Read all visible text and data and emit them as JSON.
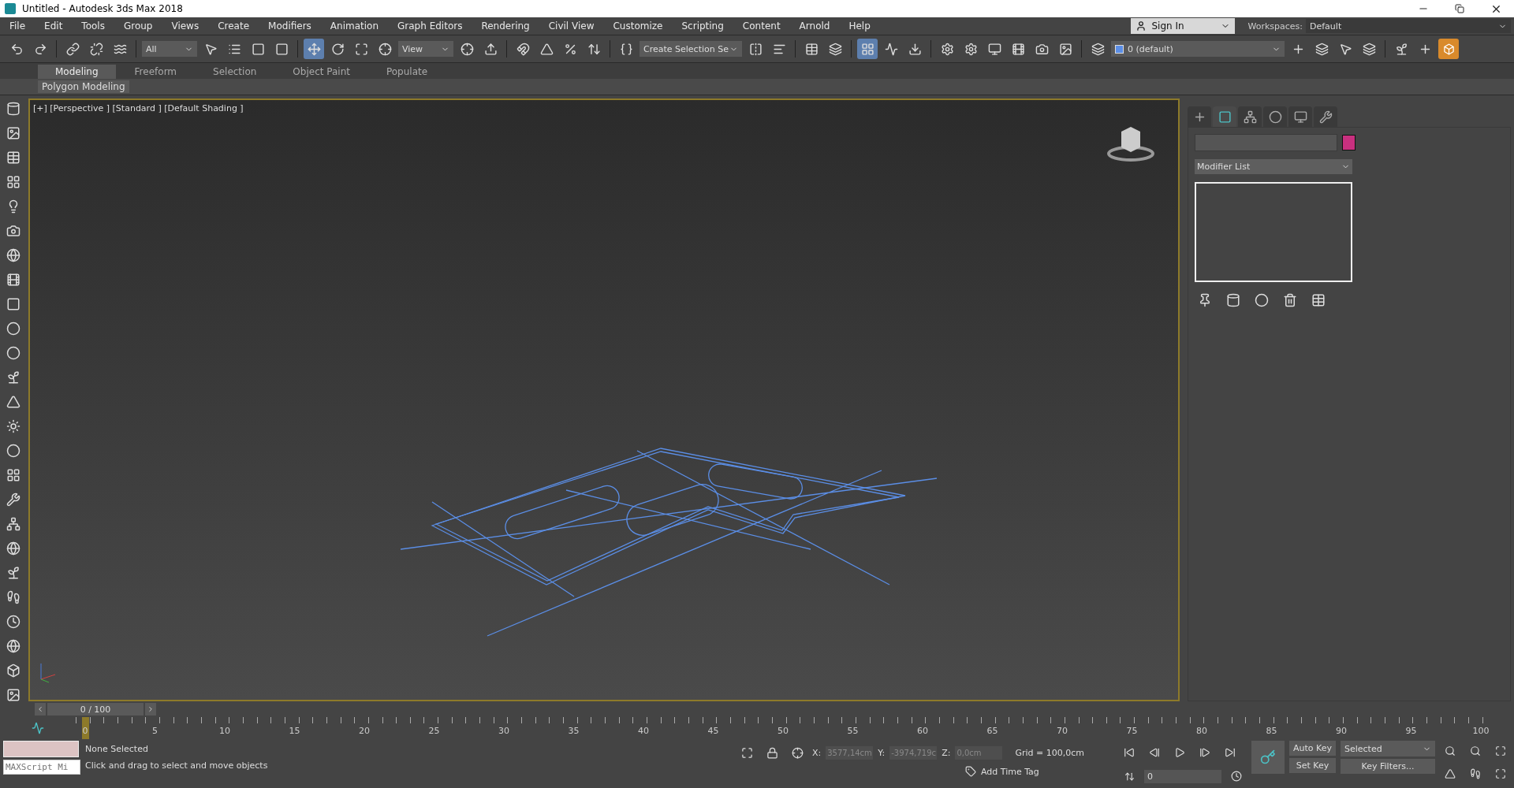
{
  "window": {
    "title": "Untitled - Autodesk 3ds Max 2018"
  },
  "menu": [
    "File",
    "Edit",
    "Tools",
    "Group",
    "Views",
    "Create",
    "Modifiers",
    "Animation",
    "Graph Editors",
    "Rendering",
    "Civil View",
    "Customize",
    "Scripting",
    "Content",
    "Arnold",
    "Help"
  ],
  "account": {
    "sign_in": "Sign In",
    "workspaces_label": "Workspaces:",
    "workspace": "Default"
  },
  "toolbar": {
    "selection_filter": "All",
    "coordinate_system": "View",
    "named_selection": "Create Selection Se",
    "layer": "0 (default)"
  },
  "ribbon": {
    "tabs": [
      {
        "label": "Modeling",
        "selected": true
      },
      {
        "label": "Freeform",
        "selected": false
      },
      {
        "label": "Selection",
        "selected": false
      },
      {
        "label": "Object Paint",
        "selected": false
      },
      {
        "label": "Populate",
        "selected": false
      }
    ],
    "panel": "Polygon Modeling"
  },
  "viewport": {
    "label": "[+] [Perspective ] [Standard ] [Default Shading ]"
  },
  "command_panel": {
    "tabs": [
      {
        "kind": "create",
        "selected": false
      },
      {
        "kind": "modify",
        "selected": true
      },
      {
        "kind": "hierarchy",
        "selected": false
      },
      {
        "kind": "motion",
        "selected": false
      },
      {
        "kind": "display",
        "selected": false
      },
      {
        "kind": "utilities",
        "selected": false
      }
    ],
    "modifier_list": "Modifier List"
  },
  "timeline": {
    "slider": "0 / 100",
    "ticks": [
      "0",
      "5",
      "10",
      "15",
      "20",
      "25",
      "30",
      "35",
      "40",
      "45",
      "50",
      "55",
      "60",
      "65",
      "70",
      "75",
      "80",
      "85",
      "90",
      "95",
      "100"
    ]
  },
  "status": {
    "maxscript_placeholder": "MAXScript Mi",
    "selection": "None Selected",
    "prompt": "Click and drag to select and move objects",
    "x_label": "X:",
    "x": "3577,14cm",
    "y_label": "Y:",
    "y": "-3974,719c",
    "z_label": "Z:",
    "z": "0,0cm",
    "grid": "Grid = 100,0cm",
    "add_time_tag": "Add Time Tag",
    "auto_key": "Auto Key",
    "set_key": "Set Key",
    "key_mode": "Selected",
    "key_filters": "Key Filters...",
    "frame": "0"
  }
}
